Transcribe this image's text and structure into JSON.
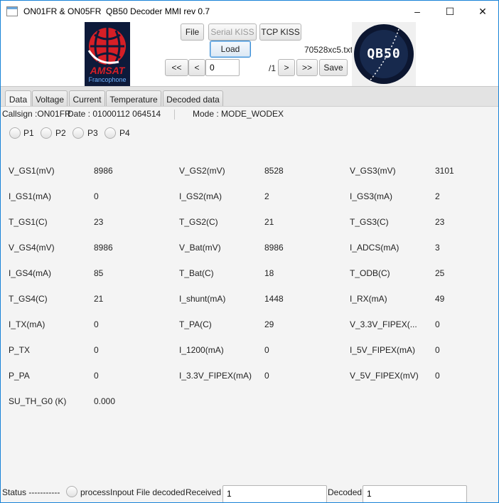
{
  "window": {
    "title": "ON01FR & ON05FR  QB50 Decoder MMI rev 0.7",
    "controls": {
      "minimize": "–",
      "maximize": "☐",
      "close": "✕"
    }
  },
  "header": {
    "amsat_logo_text": "AMSAT",
    "amsat_logo_subtext": "Francophone",
    "qb50_logo_text": "QB50",
    "buttons": {
      "file": "File",
      "serial_kiss": "Serial KISS",
      "tcp_kiss": "TCP KISS",
      "load": "Load",
      "first": "<<",
      "prev": "<",
      "next": ">",
      "last": ">>",
      "save": "Save"
    },
    "frame_index_value": "0",
    "frame_total": "/1",
    "filename": "70528xc5.txt"
  },
  "tabs": [
    "Data",
    "Voltage",
    "Current",
    "Temperature",
    "Decoded data"
  ],
  "info": {
    "callsign": "Callsign :ON01FR",
    "date": "Date : 01000112 064514",
    "mode": "Mode : MODE_WODEX"
  },
  "packets": [
    "P1",
    "P2",
    "P3",
    "P4"
  ],
  "telemetry_rows": [
    [
      [
        "V_GS1(mV)",
        "8986"
      ],
      [
        "V_GS2(mV)",
        "8528"
      ],
      [
        "V_GS3(mV)",
        "3101"
      ]
    ],
    [
      [
        "I_GS1(mA)",
        "0"
      ],
      [
        "I_GS2(mA)",
        "2"
      ],
      [
        "I_GS3(mA)",
        "2"
      ]
    ],
    [
      [
        "T_GS1(C)",
        "23"
      ],
      [
        "T_GS2(C)",
        "21"
      ],
      [
        "T_GS3(C)",
        "23"
      ]
    ],
    [
      [
        "V_GS4(mV)",
        "8986"
      ],
      [
        "V_Bat(mV)",
        "8986"
      ],
      [
        "I_ADCS(mA)",
        "3"
      ]
    ],
    [
      [
        "I_GS4(mA)",
        "85"
      ],
      [
        "T_Bat(C)",
        "18"
      ],
      [
        "T_ODB(C)",
        "25"
      ]
    ],
    [
      [
        "T_GS4(C)",
        "21"
      ],
      [
        "I_shunt(mA)",
        "1448"
      ],
      [
        "I_RX(mA)",
        "49"
      ]
    ],
    [
      [
        "I_TX(mA)",
        "0"
      ],
      [
        "T_PA(C)",
        "29"
      ],
      [
        "V_3.3V_FIPEX(...",
        "0"
      ]
    ],
    [
      [
        "P_TX",
        "0"
      ],
      [
        "I_1200(mA)",
        "0"
      ],
      [
        "I_5V_FIPEX(mA)",
        "0"
      ]
    ],
    [
      [
        "P_PA",
        "0"
      ],
      [
        "I_3.3V_FIPEX(mA)",
        "0"
      ],
      [
        "V_5V_FIPEX(mV)",
        "0"
      ]
    ],
    [
      [
        "SU_TH_G0 (K)",
        "0.000"
      ]
    ]
  ],
  "statusbar": {
    "status_label": "Status -----------",
    "process_text": "processInpout File decoded",
    "received_label": "Received",
    "received_value": "1",
    "decoded_label": "Decoded",
    "decoded_value": "1"
  }
}
